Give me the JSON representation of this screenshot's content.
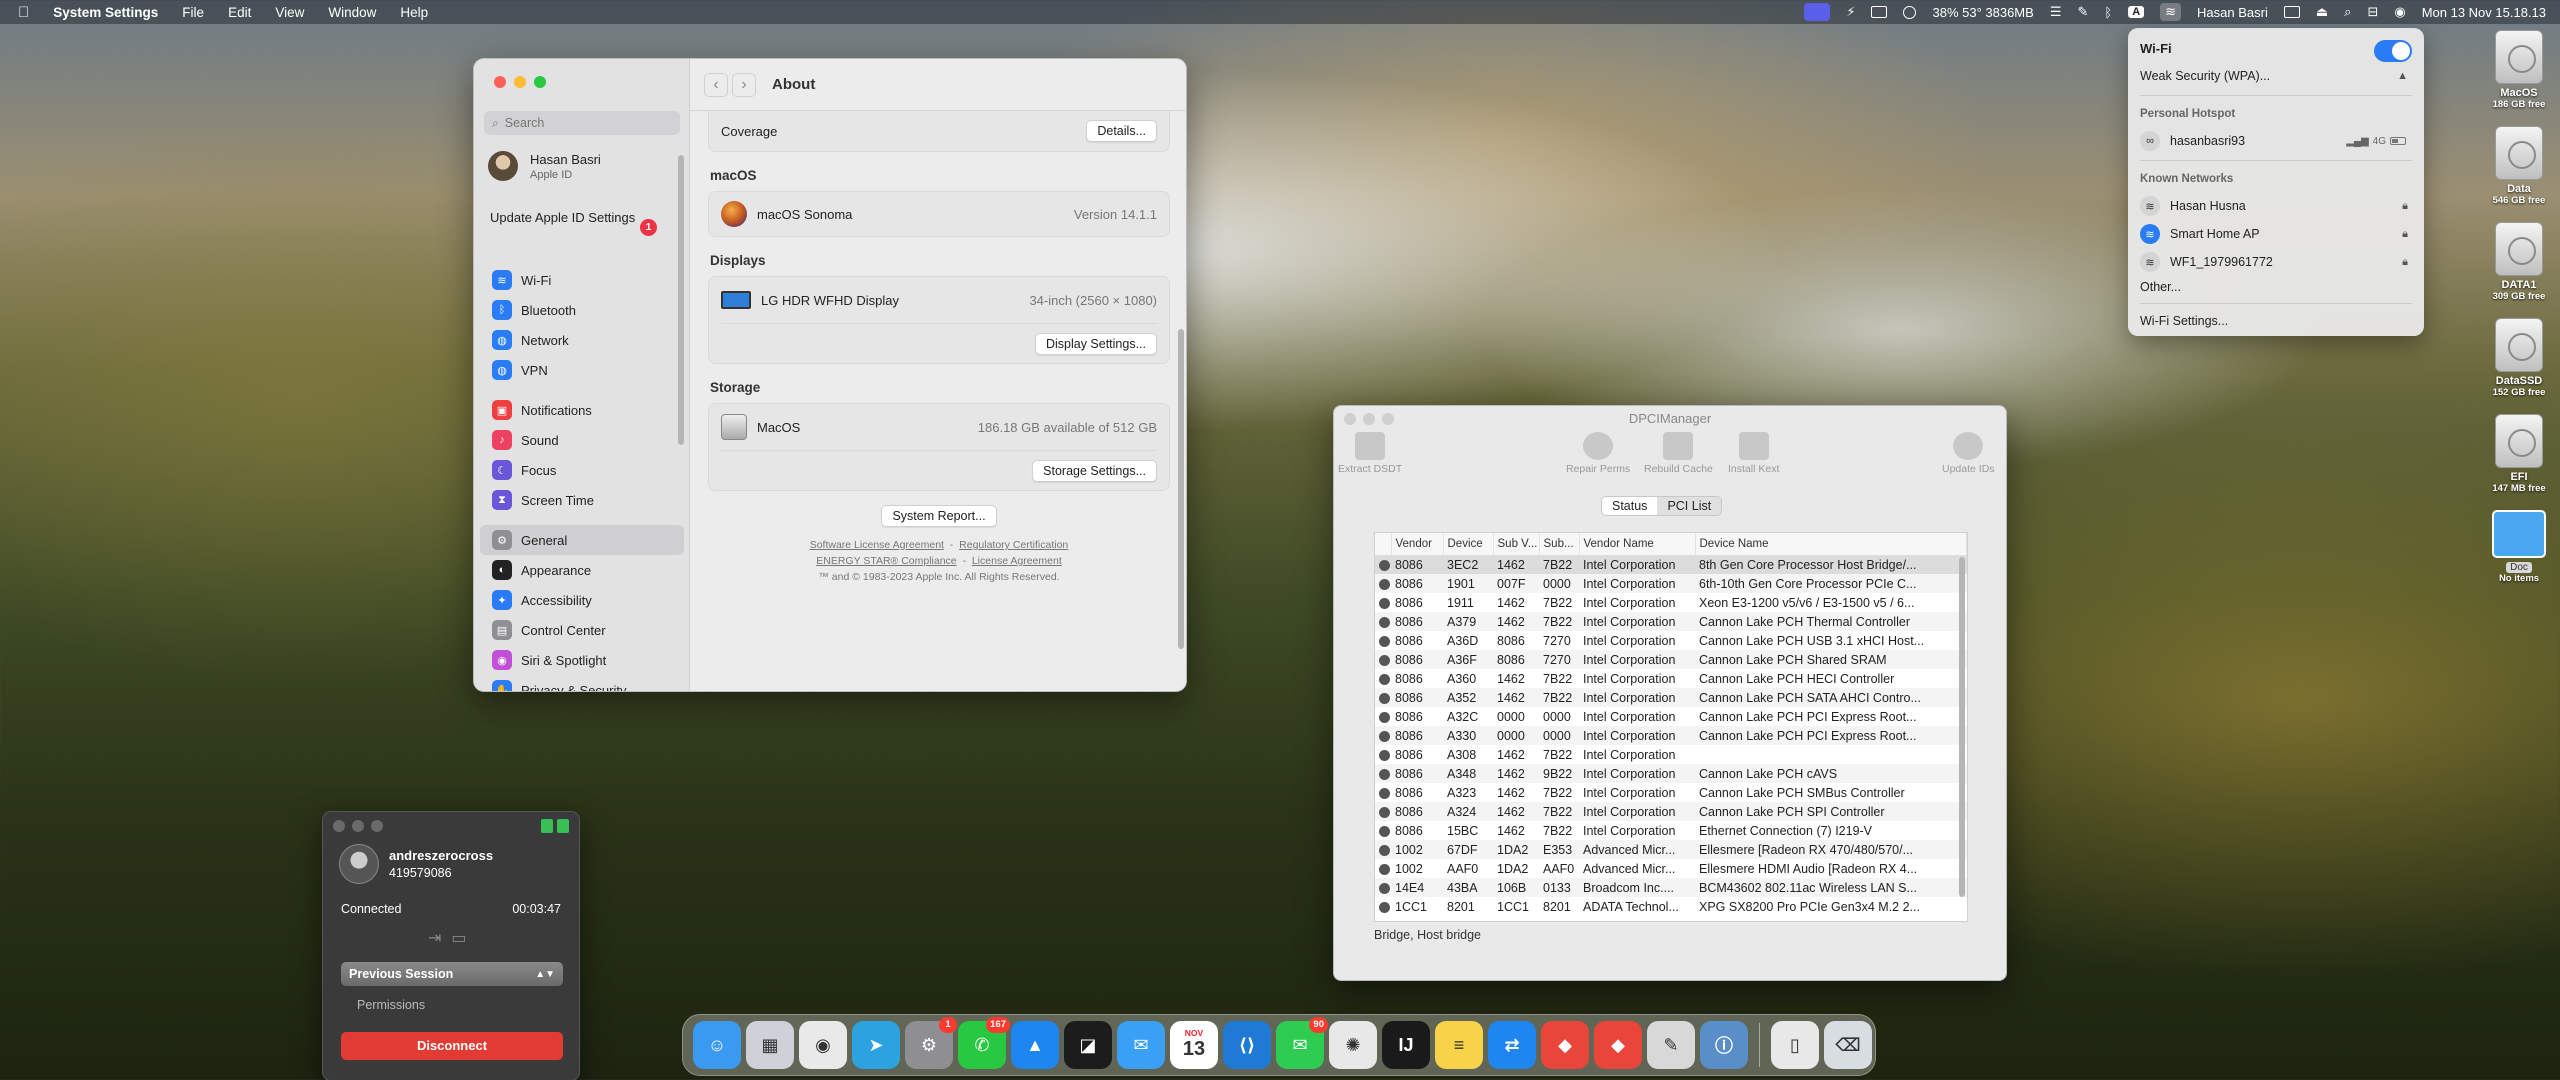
{
  "menubar": {
    "apple": "",
    "app": "System Settings",
    "menus": [
      "File",
      "Edit",
      "View",
      "Window",
      "Help"
    ],
    "stats": "38% 53° 3836MB",
    "user": "Hasan Basri",
    "clock": "Mon 13 Nov  15.18.13",
    "input_source": "A"
  },
  "wifi_panel": {
    "title": "Wi-Fi",
    "enabled": true,
    "current_warning": "Weak Security (WPA)...",
    "hotspot_section": "Personal Hotspot",
    "hotspot_name": "hasanbasri93",
    "hotspot_signal": "4G",
    "known_section": "Known Networks",
    "known_networks": [
      "Hasan Husna",
      "Smart Home AP",
      "WF1_1979961772"
    ],
    "other": "Other...",
    "settings": "Wi-Fi Settings..."
  },
  "desktop_disks": [
    {
      "name": "MacOS",
      "free": "186 GB free"
    },
    {
      "name": "Data",
      "free": "546 GB free"
    },
    {
      "name": "DATA1",
      "free": "309 GB free"
    },
    {
      "name": "DataSSD",
      "free": "152 GB free"
    },
    {
      "name": "EFI",
      "free": "147 MB free"
    }
  ],
  "desktop_folder": {
    "name": "Doc",
    "info": "No items"
  },
  "settings": {
    "search_placeholder": "Search",
    "user_name": "Hasan Basri",
    "user_sub": "Apple ID",
    "update_text": "Update Apple ID Settings",
    "update_badge": "1",
    "sidebar": [
      {
        "label": "Wi-Fi",
        "color": "#2a7cf6",
        "glyph": "≋"
      },
      {
        "label": "Bluetooth",
        "color": "#2a7cf6",
        "glyph": "ᛒ"
      },
      {
        "label": "Network",
        "color": "#2a7cf6",
        "glyph": "◍"
      },
      {
        "label": "VPN",
        "color": "#2a7cf6",
        "glyph": "◍"
      },
      {
        "label": "Notifications",
        "color": "#ee4040",
        "glyph": "▣"
      },
      {
        "label": "Sound",
        "color": "#ee4060",
        "glyph": "♪"
      },
      {
        "label": "Focus",
        "color": "#6a56d8",
        "glyph": "☾"
      },
      {
        "label": "Screen Time",
        "color": "#6a56d8",
        "glyph": "⧗"
      },
      {
        "label": "General",
        "color": "#8e8e93",
        "glyph": "⚙"
      },
      {
        "label": "Appearance",
        "color": "#222222",
        "glyph": "◐"
      },
      {
        "label": "Accessibility",
        "color": "#2a7cf6",
        "glyph": "✦"
      },
      {
        "label": "Control Center",
        "color": "#8e8e93",
        "glyph": "▤"
      },
      {
        "label": "Siri & Spotlight",
        "color": "#c050d8",
        "glyph": "◉"
      },
      {
        "label": "Privacy & Security",
        "color": "#2a7cf6",
        "glyph": "✋"
      }
    ],
    "selected": "General",
    "page_title": "About",
    "coverage_label": "Coverage",
    "details_button": "Details...",
    "macos_section": "macOS",
    "macos_name": "macOS Sonoma",
    "macos_version": "Version 14.1.1",
    "displays_section": "Displays",
    "display_name": "LG HDR WFHD Display",
    "display_info": "34-inch (2560 × 1080)",
    "display_button": "Display Settings...",
    "storage_section": "Storage",
    "storage_name": "MacOS",
    "storage_info": "186.18 GB available of 512 GB",
    "storage_button": "Storage Settings...",
    "report_button": "System Report...",
    "link1": "Software License Agreement",
    "link2": "Regulatory Certification",
    "link3": "ENERGY STAR® Compliance",
    "link4": "License Agreement",
    "copyright": "™ and © 1983-2023 Apple Inc. All Rights Reserved.",
    "sep": "-"
  },
  "dpci": {
    "title": "DPCIManager",
    "tools": [
      "Extract DSDT",
      "Repair Perms",
      "Rebuild Cache",
      "Install Kext",
      "Update IDs"
    ],
    "tabs": [
      "Status",
      "PCI List"
    ],
    "active_tab": "PCI List",
    "columns": [
      "",
      "Vendor",
      "Device",
      "Sub V...",
      "Sub...",
      "Vendor Name",
      "Device Name"
    ],
    "rows": [
      [
        "8086",
        "3EC2",
        "1462",
        "7B22",
        "Intel Corporation",
        "8th Gen Core Processor Host Bridge/..."
      ],
      [
        "8086",
        "1901",
        "007F",
        "0000",
        "Intel Corporation",
        "6th-10th Gen Core Processor PCIe C..."
      ],
      [
        "8086",
        "1911",
        "1462",
        "7B22",
        "Intel Corporation",
        "Xeon E3-1200 v5/v6 / E3-1500 v5 / 6..."
      ],
      [
        "8086",
        "A379",
        "1462",
        "7B22",
        "Intel Corporation",
        "Cannon Lake PCH Thermal Controller"
      ],
      [
        "8086",
        "A36D",
        "8086",
        "7270",
        "Intel Corporation",
        "Cannon Lake PCH USB 3.1 xHCI Host..."
      ],
      [
        "8086",
        "A36F",
        "8086",
        "7270",
        "Intel Corporation",
        "Cannon Lake PCH Shared SRAM"
      ],
      [
        "8086",
        "A360",
        "1462",
        "7B22",
        "Intel Corporation",
        "Cannon Lake PCH HECI Controller"
      ],
      [
        "8086",
        "A352",
        "1462",
        "7B22",
        "Intel Corporation",
        "Cannon Lake PCH SATA AHCI Contro..."
      ],
      [
        "8086",
        "A32C",
        "0000",
        "0000",
        "Intel Corporation",
        "Cannon Lake PCH PCI Express Root..."
      ],
      [
        "8086",
        "A330",
        "0000",
        "0000",
        "Intel Corporation",
        "Cannon Lake PCH PCI Express Root..."
      ],
      [
        "8086",
        "A308",
        "1462",
        "7B22",
        "Intel Corporation",
        ""
      ],
      [
        "8086",
        "A348",
        "1462",
        "9B22",
        "Intel Corporation",
        "Cannon Lake PCH cAVS"
      ],
      [
        "8086",
        "A323",
        "1462",
        "7B22",
        "Intel Corporation",
        "Cannon Lake PCH SMBus Controller"
      ],
      [
        "8086",
        "A324",
        "1462",
        "7B22",
        "Intel Corporation",
        "Cannon Lake PCH SPI Controller"
      ],
      [
        "8086",
        "15BC",
        "1462",
        "7B22",
        "Intel Corporation",
        "Ethernet Connection (7) I219-V"
      ],
      [
        "1002",
        "67DF",
        "1DA2",
        "E353",
        "Advanced Micr...",
        "Ellesmere [Radeon RX 470/480/570/..."
      ],
      [
        "1002",
        "AAF0",
        "1DA2",
        "AAF0",
        "Advanced Micr...",
        "Ellesmere HDMI Audio [Radeon RX 4..."
      ],
      [
        "14E4",
        "43BA",
        "106B",
        "0133",
        "Broadcom Inc....",
        "BCM43602 802.11ac Wireless LAN S..."
      ],
      [
        "1CC1",
        "8201",
        "1CC1",
        "8201",
        "ADATA Technol...",
        "XPG SX8200 Pro PCIe Gen3x4 M.2 2..."
      ]
    ],
    "status": "Bridge, Host bridge"
  },
  "remote": {
    "user": "andreszerocross",
    "id": "419579086",
    "status": "Connected",
    "timer": "00:03:47",
    "session_select": "Previous Session",
    "permissions": "Permissions",
    "disconnect": "Disconnect"
  },
  "dock": {
    "apps": [
      {
        "name": "finder",
        "color": "#3a9af2",
        "glyph": "☺"
      },
      {
        "name": "launchpad",
        "color": "#d0d0d8",
        "glyph": "▦"
      },
      {
        "name": "chrome",
        "color": "#e9e9e9",
        "glyph": "◉"
      },
      {
        "name": "telegram",
        "color": "#2aa3e0",
        "glyph": "➤"
      },
      {
        "name": "system-settings",
        "color": "#8e8e93",
        "glyph": "⚙",
        "badge": "1"
      },
      {
        "name": "whatsapp",
        "color": "#28c840",
        "glyph": "✆",
        "badge": "167"
      },
      {
        "name": "testflight",
        "color": "#1e86f0",
        "glyph": "▲"
      },
      {
        "name": "cursor",
        "color": "#1c1c1c",
        "glyph": "◪"
      },
      {
        "name": "mail",
        "color": "#3aa0f5",
        "glyph": "✉"
      },
      {
        "name": "calendar",
        "color": "#ffffff",
        "glyph": "13",
        "month": "NOV"
      },
      {
        "name": "vscode",
        "color": "#1f7ad6",
        "glyph": "⟨⟩"
      },
      {
        "name": "messages",
        "color": "#2fcc52",
        "glyph": "✉",
        "badge": "90"
      },
      {
        "name": "chatgpt",
        "color": "#e8e8e8",
        "glyph": "✺"
      },
      {
        "name": "intellij",
        "color": "#1a1a1a",
        "glyph": "IJ"
      },
      {
        "name": "notes",
        "color": "#f8d34a",
        "glyph": "≡"
      },
      {
        "name": "remote-app",
        "color": "#1e86f0",
        "glyph": "⇄"
      },
      {
        "name": "anydesk",
        "color": "#e8463a",
        "glyph": "◆"
      },
      {
        "name": "anydesk-2",
        "color": "#e8463a",
        "glyph": "◆"
      },
      {
        "name": "preview",
        "color": "#d8d8d8",
        "glyph": "✎"
      },
      {
        "name": "system-info",
        "color": "#5a8ec8",
        "glyph": "ⓘ"
      }
    ],
    "trailing": [
      {
        "name": "document",
        "color": "#e8e8e8",
        "glyph": "▯"
      },
      {
        "name": "trash",
        "color": "#d8dde2",
        "glyph": "⌫"
      }
    ]
  }
}
